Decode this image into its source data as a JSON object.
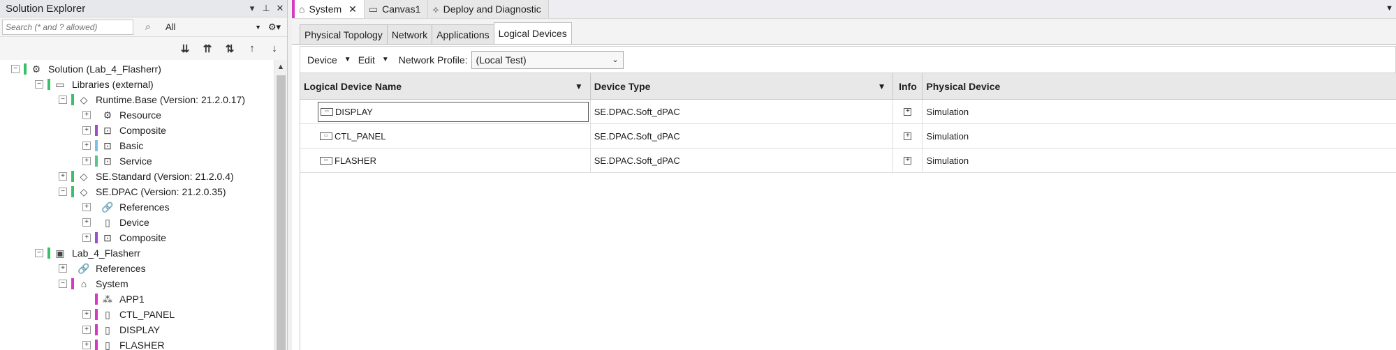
{
  "solution_explorer": {
    "title": "Solution Explorer",
    "search_placeholder": "Search (* and ? allowed)",
    "filter_value": "All",
    "tree": [
      {
        "label": "Solution  (Lab_4_Flasherr)",
        "level": 0,
        "expander": "−",
        "bar": "#3cbf6a",
        "icon": "⚙"
      },
      {
        "label": "Libraries (external)",
        "level": 1,
        "expander": "−",
        "bar": "#3cbf6a",
        "icon": "▭"
      },
      {
        "label": "Runtime.Base  (Version: 21.2.0.17)",
        "level": 2,
        "expander": "−",
        "bar": "#3cbf6a",
        "icon": "◇"
      },
      {
        "label": "Resource",
        "level": 3,
        "expander": "+",
        "bar": "",
        "icon": "⚙"
      },
      {
        "label": "Composite",
        "level": 3,
        "expander": "+",
        "bar": "#9b4fc9",
        "icon": "⊡"
      },
      {
        "label": "Basic",
        "level": 3,
        "expander": "+",
        "bar": "#7ac2e8",
        "icon": "⊡"
      },
      {
        "label": "Service",
        "level": 3,
        "expander": "+",
        "bar": "#5cc48a",
        "icon": "⊡"
      },
      {
        "label": "SE.Standard  (Version: 21.2.0.4)",
        "level": 2,
        "expander": "+",
        "bar": "#3cbf6a",
        "icon": "◇"
      },
      {
        "label": "SE.DPAC  (Version: 21.2.0.35)",
        "level": 2,
        "expander": "−",
        "bar": "#3cbf6a",
        "icon": "◇"
      },
      {
        "label": "References",
        "level": 3,
        "expander": "+",
        "bar": "",
        "icon": "🔗"
      },
      {
        "label": "Device",
        "level": 3,
        "expander": "+",
        "bar": "",
        "icon": "▯"
      },
      {
        "label": "Composite",
        "level": 3,
        "expander": "+",
        "bar": "#9b4fc9",
        "icon": "⊡"
      },
      {
        "label": "Lab_4_Flasherr",
        "level": 1,
        "expander": "−",
        "bar": "#3cbf6a",
        "icon": "▣"
      },
      {
        "label": "References",
        "level": 2,
        "expander": "+",
        "bar": "",
        "icon": "🔗"
      },
      {
        "label": "System",
        "level": 2,
        "expander": "−",
        "bar": "#d63ac4",
        "icon": "⌂"
      },
      {
        "label": "APP1",
        "level": 3,
        "expander": "",
        "bar": "#d63ac4",
        "icon": "⁂"
      },
      {
        "label": "CTL_PANEL",
        "level": 3,
        "expander": "+",
        "bar": "#d63ac4",
        "icon": "▯"
      },
      {
        "label": "DISPLAY",
        "level": 3,
        "expander": "+",
        "bar": "#d63ac4",
        "icon": "▯"
      },
      {
        "label": "FLASHER",
        "level": 3,
        "expander": "+",
        "bar": "#d63ac4",
        "icon": "▯"
      }
    ]
  },
  "doc_tabs": [
    {
      "label": "System",
      "icon": "⌂",
      "active": true,
      "close": "✕"
    },
    {
      "label": "Canvas1",
      "icon": "▭",
      "active": false,
      "close": ""
    },
    {
      "label": "Deploy and Diagnostic",
      "icon": "⟡",
      "active": false,
      "close": ""
    }
  ],
  "sub_tabs": [
    {
      "label": "Physical Topology",
      "active": false
    },
    {
      "label": "Network",
      "active": false
    },
    {
      "label": "Applications",
      "active": false
    },
    {
      "label": "Logical Devices",
      "active": true
    }
  ],
  "toolbar": {
    "device_label": "Device",
    "edit_label": "Edit",
    "network_profile_label": "Network Profile:",
    "network_profile_value": "(Local Test)"
  },
  "grid": {
    "columns": [
      "Logical Device Name",
      "Device Type",
      "Info",
      "Physical Device"
    ],
    "rows": [
      {
        "name": "DISPLAY",
        "type": "SE.DPAC.Soft_dPAC",
        "info": "+",
        "physical": "Simulation",
        "selected": true
      },
      {
        "name": "CTL_PANEL",
        "type": "SE.DPAC.Soft_dPAC",
        "info": "+",
        "physical": "Simulation",
        "selected": false
      },
      {
        "name": "FLASHER",
        "type": "SE.DPAC.Soft_dPAC",
        "info": "+",
        "physical": "Simulation",
        "selected": false
      }
    ]
  }
}
